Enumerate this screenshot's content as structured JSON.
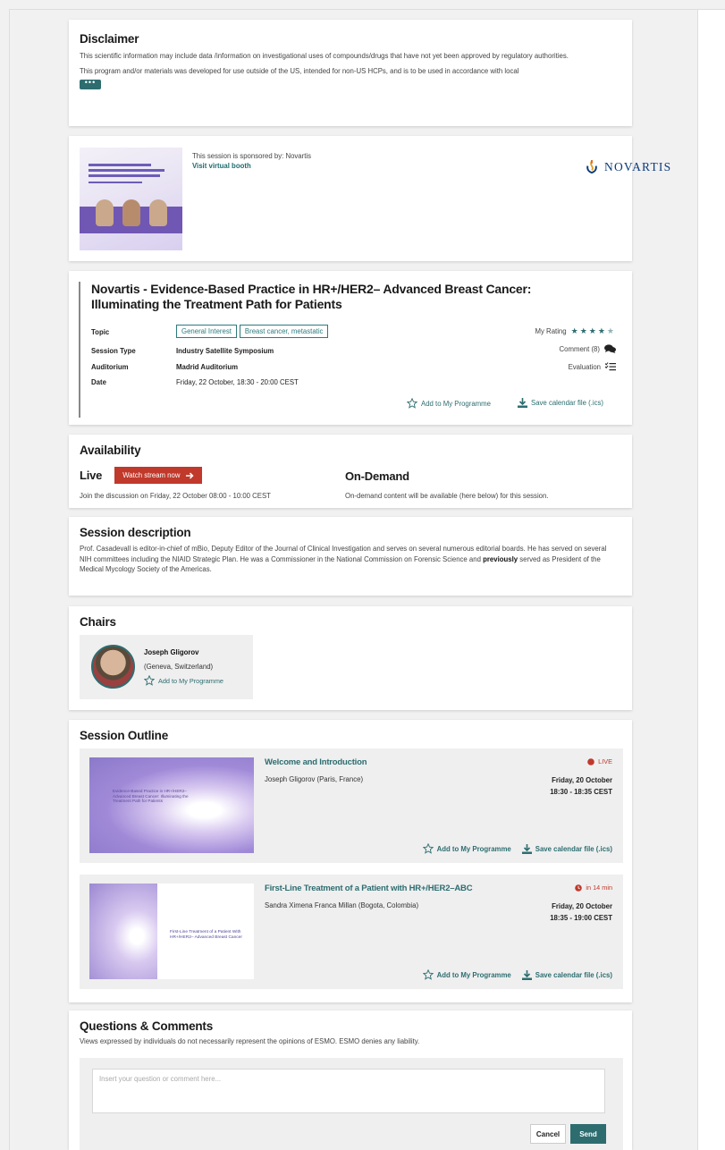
{
  "disclaimer": {
    "title": "Disclaimer",
    "line1": "This scientific information may include data /information on investigational uses of compounds/drugs  that have not yet been approved by regulatory authorities.",
    "line2": "This program and/or materials was developed for use outside of the US, intended for non-US HCPs, and is to be used in accordance with local",
    "more_label": "•••"
  },
  "sponsor": {
    "sponsored_by": "This session is sponsored by: Novartis",
    "booth_link": "Visit virtual booth",
    "logo_text": "NOVARTIS"
  },
  "session": {
    "title": "Novartis - Evidence-Based Practice in HR+/HER2– Advanced Breast Cancer: Illuminating the Treatment Path for Patients",
    "topic_label": "Topic",
    "topics": [
      "General Interest",
      "Breast cancer, metastatic"
    ],
    "type_label": "Session Type",
    "type_value": "Industry Satellite Symposium",
    "auditorium_label": "Auditorium",
    "auditorium_value": "Madrid Auditorium",
    "date_label": "Date",
    "date_value": "Friday, 22 October, 18:30 - 20:00 CEST",
    "rating_label": "My Rating",
    "rating": 4,
    "rating_max": 5,
    "comment_label": "Comment (8)",
    "evaluation_label": "Evaluation",
    "add_label": "Add to My Programme",
    "calendar_label": "Save calendar file (.ics)"
  },
  "availability": {
    "title": "Availability",
    "live_label": "Live",
    "watch_label": "Watch stream now",
    "live_text": "Join the discussion on Friday, 22 October 08:00 - 10:00 CEST",
    "ondemand_label": "On-Demand",
    "ondemand_text": "On-demand content will be available (here below) for this session."
  },
  "description": {
    "title": "Session description",
    "text_before": "Prof. Casadevall is editor-in-chief of mBio, Deputy Editor of the Journal of Clinical Investigation and serves on several numerous editorial boards. He has served on several NIH committees including the NIAID Strategic Plan. He was a Commissioner in the National Commission on Forensic Science and ",
    "text_bold": "previously",
    "text_after": " served as President of the Medical Mycology Society of the Americas."
  },
  "chairs": {
    "title": "Chairs",
    "name": "Joseph Gligorov",
    "location": "(Geneva, Switzerland)",
    "add_label": "Add to My Programme"
  },
  "outline": {
    "title": "Session Outline",
    "items": [
      {
        "title": "Welcome and Introduction",
        "speaker": "Joseph Gligorov (Paris, France)",
        "status": "LIVE",
        "date": "Friday, 20 October",
        "time": "18:30 - 18:35 CEST",
        "add_label": "Add to My Programme",
        "calendar_label": "Save calendar file (.ics)",
        "thumb_caption": "Evidence-Based Practice in HR+/HER2– Advanced Breast Cancer: Illuminating the Treatment Path for Patients"
      },
      {
        "title": "First-Line Treatment of a Patient with HR+/HER2–ABC",
        "speaker": "Sandra Ximena Franca Millan (Bogota, Colombia)",
        "status": "in 14 min",
        "date": "Friday, 20 October",
        "time": "18:35 - 19:00 CEST",
        "add_label": "Add to My Programme",
        "calendar_label": "Save calendar file (.ics)",
        "thumb_caption": "First-Line Treatment of a Patient With HR+/HER2– Advanced Breast Cancer"
      }
    ]
  },
  "questions": {
    "title": "Questions & Comments",
    "disclaimer": "Views expressed by individuals do not necessarily represent the opinions of ESMO. ESMO denies any liability.",
    "placeholder": "Insert your question or comment here...",
    "cancel_label": "Cancel",
    "send_label": "Send"
  },
  "colors": {
    "accent": "#2d6d70",
    "live": "#c0392b",
    "brand": "#0a3b7a"
  }
}
